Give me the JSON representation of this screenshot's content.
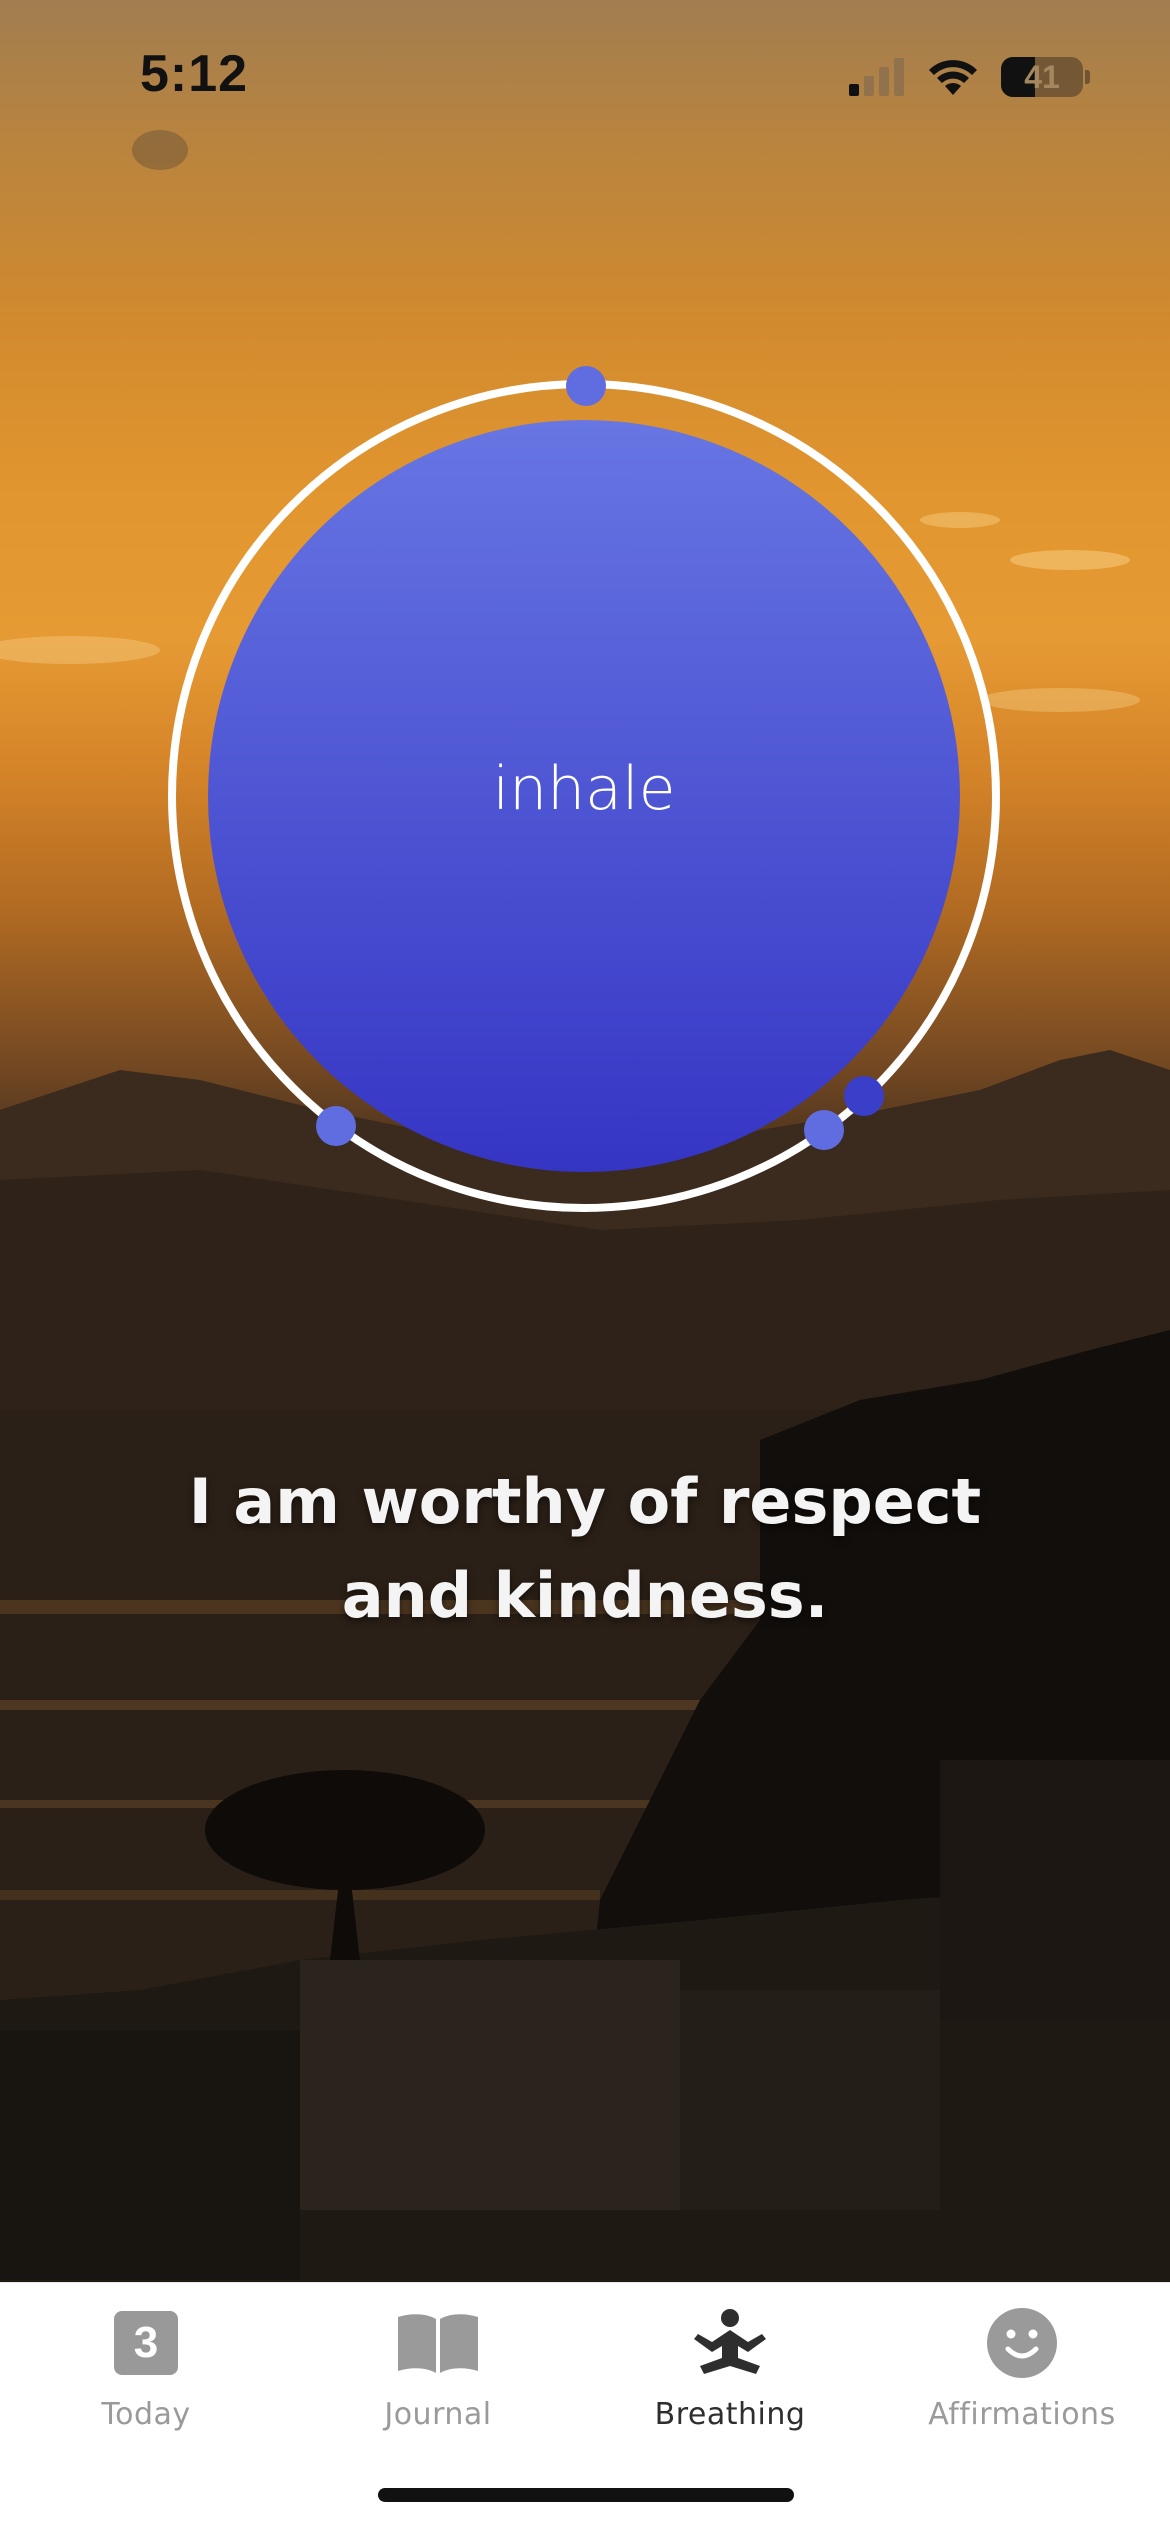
{
  "status_bar": {
    "time": "5:12",
    "battery_level": "41",
    "battery_fraction": 0.41,
    "signal_bars_active": 1,
    "icons": [
      "cellular-signal-icon",
      "wifi-icon",
      "battery-icon"
    ]
  },
  "breathing": {
    "phase": "inhale",
    "colors": {
      "circle_top": "#6776e3",
      "circle_bottom": "#3535c4",
      "ring": "#ffffff",
      "marker": "#5f6de0"
    }
  },
  "affirmation": {
    "line1": "I am worthy of respect",
    "line2": "and kindness."
  },
  "tab_bar": {
    "active": "breathing",
    "tabs": [
      {
        "id": "today",
        "label": "Today",
        "badge": "3",
        "icon": "calendar-badge-icon"
      },
      {
        "id": "journal",
        "label": "Journal",
        "icon": "open-book-icon"
      },
      {
        "id": "breathing",
        "label": "Breathing",
        "icon": "meditation-pose-icon"
      },
      {
        "id": "affirmations",
        "label": "Affirmations",
        "icon": "smiley-face-icon"
      }
    ],
    "colors": {
      "active_label": "#2e2e2e",
      "inactive": "#9a9a9a"
    }
  }
}
